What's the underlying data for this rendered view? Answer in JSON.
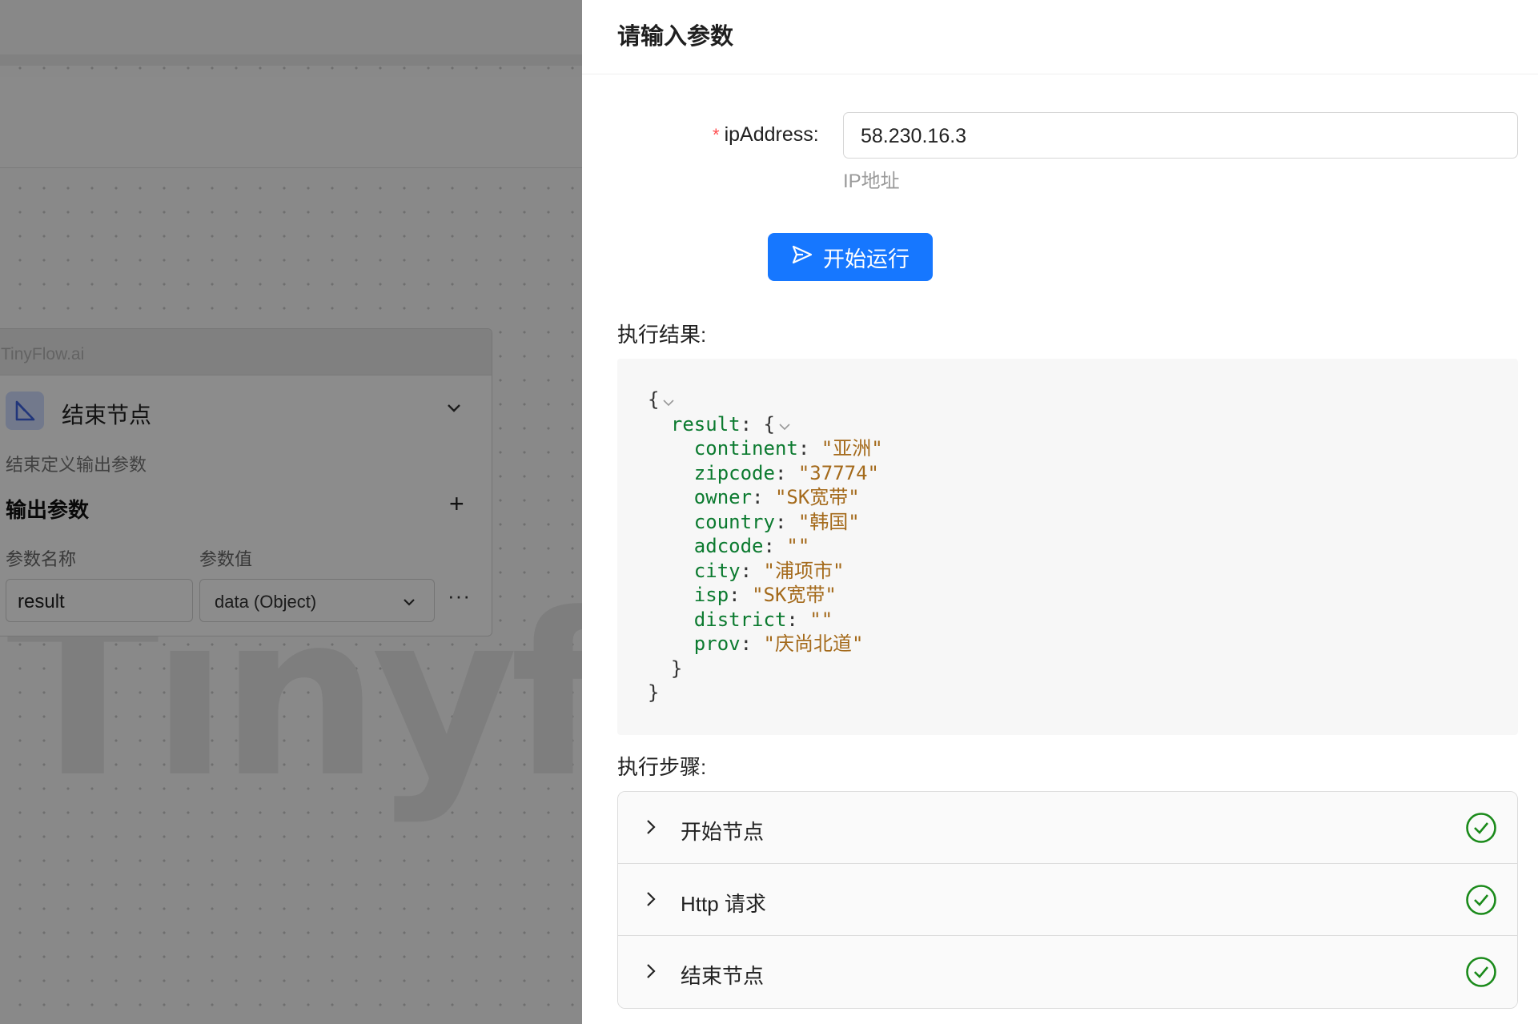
{
  "canvas": {
    "brand": "TinyFlow.ai",
    "watermark": "Tinyfl",
    "node": {
      "icon": "end-node-icon",
      "title": "结束节点",
      "description": "结束定义输出参数",
      "output_title": "输出参数",
      "add_icon": "plus-icon",
      "col_name_header": "参数名称",
      "col_value_header": "参数值",
      "param_name": "result",
      "param_value": "data (Object)",
      "more_icon": "ellipsis-icon"
    }
  },
  "drawer": {
    "title": "请输入参数",
    "field": {
      "required_mark": "*",
      "label": "ipAddress:",
      "value": "58.230.16.3",
      "help": "IP地址"
    },
    "run_button": {
      "label": "开始运行",
      "icon": "send-icon"
    },
    "result_label": "执行结果:",
    "result_json": {
      "open": "{",
      "result_key": "result",
      "colon": ": ",
      "open_inner": "{",
      "entries": [
        {
          "key": "continent",
          "value": "\"亚洲\""
        },
        {
          "key": "zipcode",
          "value": "\"37774\""
        },
        {
          "key": "owner",
          "value": "\"SK宽带\""
        },
        {
          "key": "country",
          "value": "\"韩国\""
        },
        {
          "key": "adcode",
          "value": "\"\""
        },
        {
          "key": "city",
          "value": "\"浦项市\""
        },
        {
          "key": "isp",
          "value": "\"SK宽带\""
        },
        {
          "key": "district",
          "value": "\"\""
        },
        {
          "key": "prov",
          "value": "\"庆尚北道\""
        }
      ],
      "close_inner": "}",
      "close": "}"
    },
    "steps_label": "执行步骤:",
    "steps": [
      {
        "label": "开始节点",
        "status_icon": "check-circle-icon",
        "status_color": "#1a8a1a"
      },
      {
        "label": "Http 请求",
        "status_icon": "check-circle-icon",
        "status_color": "#1a8a1a"
      },
      {
        "label": "结束节点",
        "status_icon": "check-circle-icon",
        "status_color": "#1a8a1a"
      }
    ],
    "colors": {
      "primary": "#1677ff",
      "json_key": "#0b7a2f",
      "json_string": "#a46a1b"
    }
  }
}
